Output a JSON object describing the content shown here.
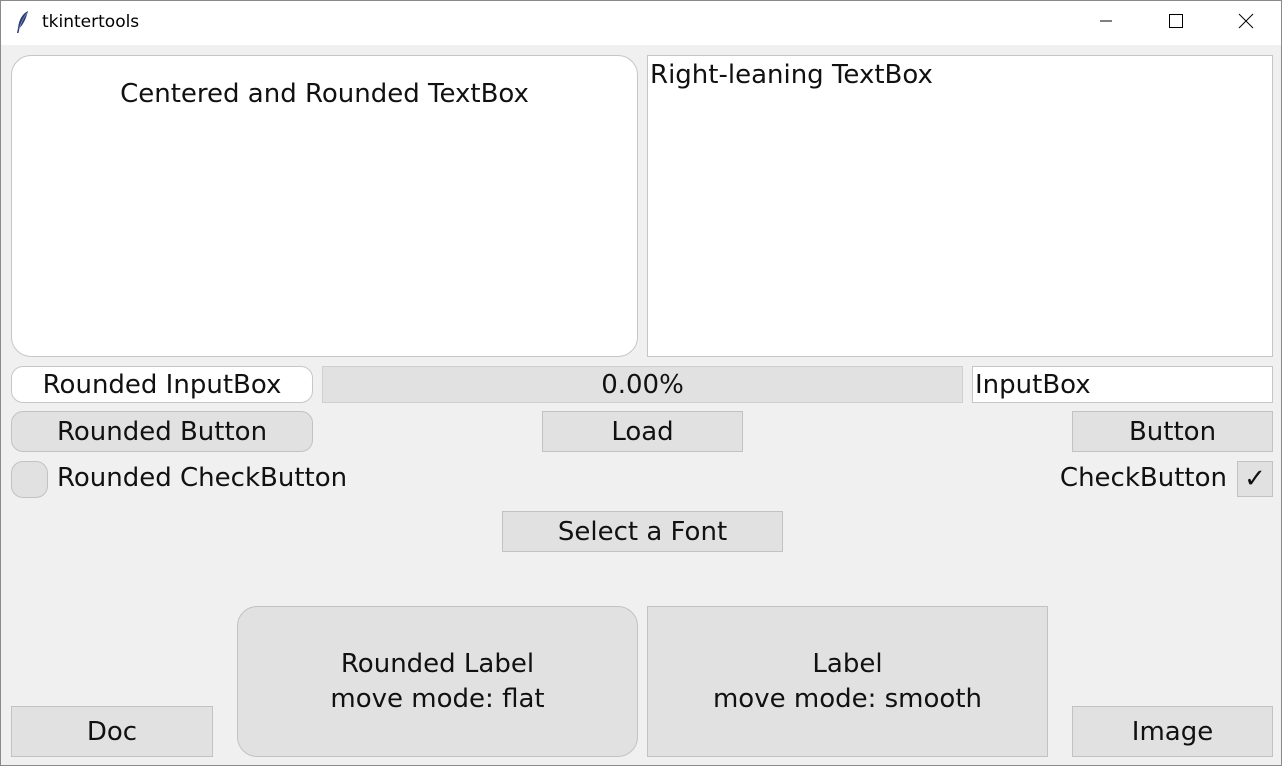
{
  "window": {
    "title": "tkintertools",
    "icon": "feather-icon",
    "controls": [
      "minimize-icon",
      "maximize-icon",
      "close-icon"
    ]
  },
  "textboxes": {
    "rounded": "Centered and Rounded TextBox",
    "right": "Right-leaning TextBox"
  },
  "inputs": {
    "rounded": "Rounded InputBox",
    "plain": "InputBox"
  },
  "progress": {
    "label": "0.00%",
    "value": 0.0,
    "fill_color": "#1aa04a"
  },
  "buttons": {
    "rounded": "Rounded Button",
    "load": "Load",
    "plain": "Button",
    "font": "Select a Font",
    "doc": "Doc",
    "image": "Image"
  },
  "checkbuttons": {
    "rounded": {
      "label": "Rounded CheckButton",
      "checked": false
    },
    "plain": {
      "label": "CheckButton",
      "checked": true,
      "mark": "✓"
    }
  },
  "labels": {
    "rounded": {
      "line1": "Rounded Label",
      "line2": "move mode: flat"
    },
    "plain": {
      "line1": "Label",
      "line2": "move mode: smooth"
    }
  }
}
